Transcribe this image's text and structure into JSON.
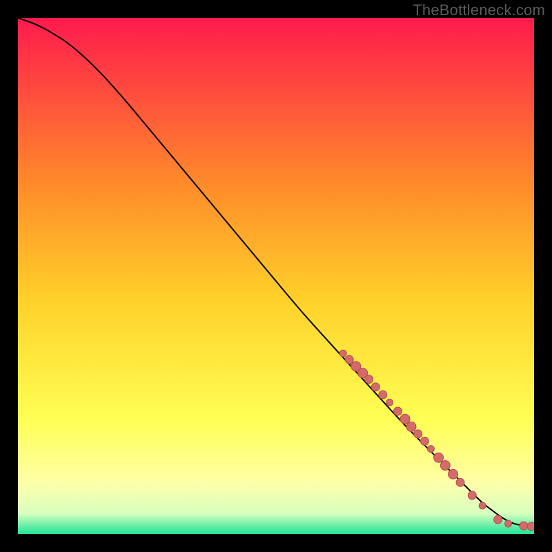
{
  "watermark": "TheBottleneck.com",
  "colors": {
    "bg": "#000000",
    "grad_top": "#ff1a4d",
    "grad_mid1": "#ff8a2a",
    "grad_mid2": "#ffd22a",
    "grad_mid3": "#ffff55",
    "grad_yellowpale": "#ffffa8",
    "grad_green": "#20e398",
    "curve": "#000000",
    "marker_fill": "#d46a6a",
    "marker_stroke": "#b04e4e"
  },
  "chart_data": {
    "type": "line",
    "title": "",
    "xlabel": "",
    "ylabel": "",
    "xlim": [
      0,
      100
    ],
    "ylim": [
      0,
      100
    ],
    "series": [
      {
        "name": "bottleneck-curve",
        "x": [
          0,
          3,
          6,
          10,
          15,
          20,
          25,
          30,
          35,
          40,
          45,
          50,
          55,
          60,
          65,
          70,
          75,
          80,
          85,
          88,
          90,
          92,
          94,
          96,
          98,
          100
        ],
        "y": [
          100,
          99,
          97.5,
          95,
          90.5,
          85,
          79,
          73,
          67,
          61,
          55,
          49,
          43,
          37.5,
          32,
          26.5,
          21,
          16,
          11,
          8,
          6,
          4.5,
          3,
          2,
          1.6,
          1.5
        ]
      }
    ],
    "markers": [
      {
        "x": 63.0,
        "y": 35.0,
        "r": 5
      },
      {
        "x": 64.2,
        "y": 33.8,
        "r": 6
      },
      {
        "x": 65.5,
        "y": 32.5,
        "r": 7
      },
      {
        "x": 66.8,
        "y": 31.2,
        "r": 7
      },
      {
        "x": 68.0,
        "y": 30.0,
        "r": 6
      },
      {
        "x": 69.3,
        "y": 28.5,
        "r": 6
      },
      {
        "x": 70.7,
        "y": 27.0,
        "r": 6
      },
      {
        "x": 72.0,
        "y": 25.5,
        "r": 5
      },
      {
        "x": 73.6,
        "y": 23.8,
        "r": 6
      },
      {
        "x": 75.0,
        "y": 22.3,
        "r": 7
      },
      {
        "x": 76.2,
        "y": 20.8,
        "r": 7
      },
      {
        "x": 77.5,
        "y": 19.4,
        "r": 6
      },
      {
        "x": 78.8,
        "y": 18.0,
        "r": 6
      },
      {
        "x": 80.0,
        "y": 16.5,
        "r": 5
      },
      {
        "x": 81.5,
        "y": 14.8,
        "r": 7
      },
      {
        "x": 82.8,
        "y": 13.3,
        "r": 7
      },
      {
        "x": 84.3,
        "y": 11.6,
        "r": 7
      },
      {
        "x": 85.7,
        "y": 10.0,
        "r": 6
      },
      {
        "x": 88.0,
        "y": 7.5,
        "r": 6
      },
      {
        "x": 90.0,
        "y": 5.5,
        "r": 5
      },
      {
        "x": 93.0,
        "y": 2.8,
        "r": 6
      },
      {
        "x": 95.0,
        "y": 2.0,
        "r": 5
      },
      {
        "x": 98.0,
        "y": 1.6,
        "r": 6
      },
      {
        "x": 99.5,
        "y": 1.5,
        "r": 6
      }
    ]
  }
}
